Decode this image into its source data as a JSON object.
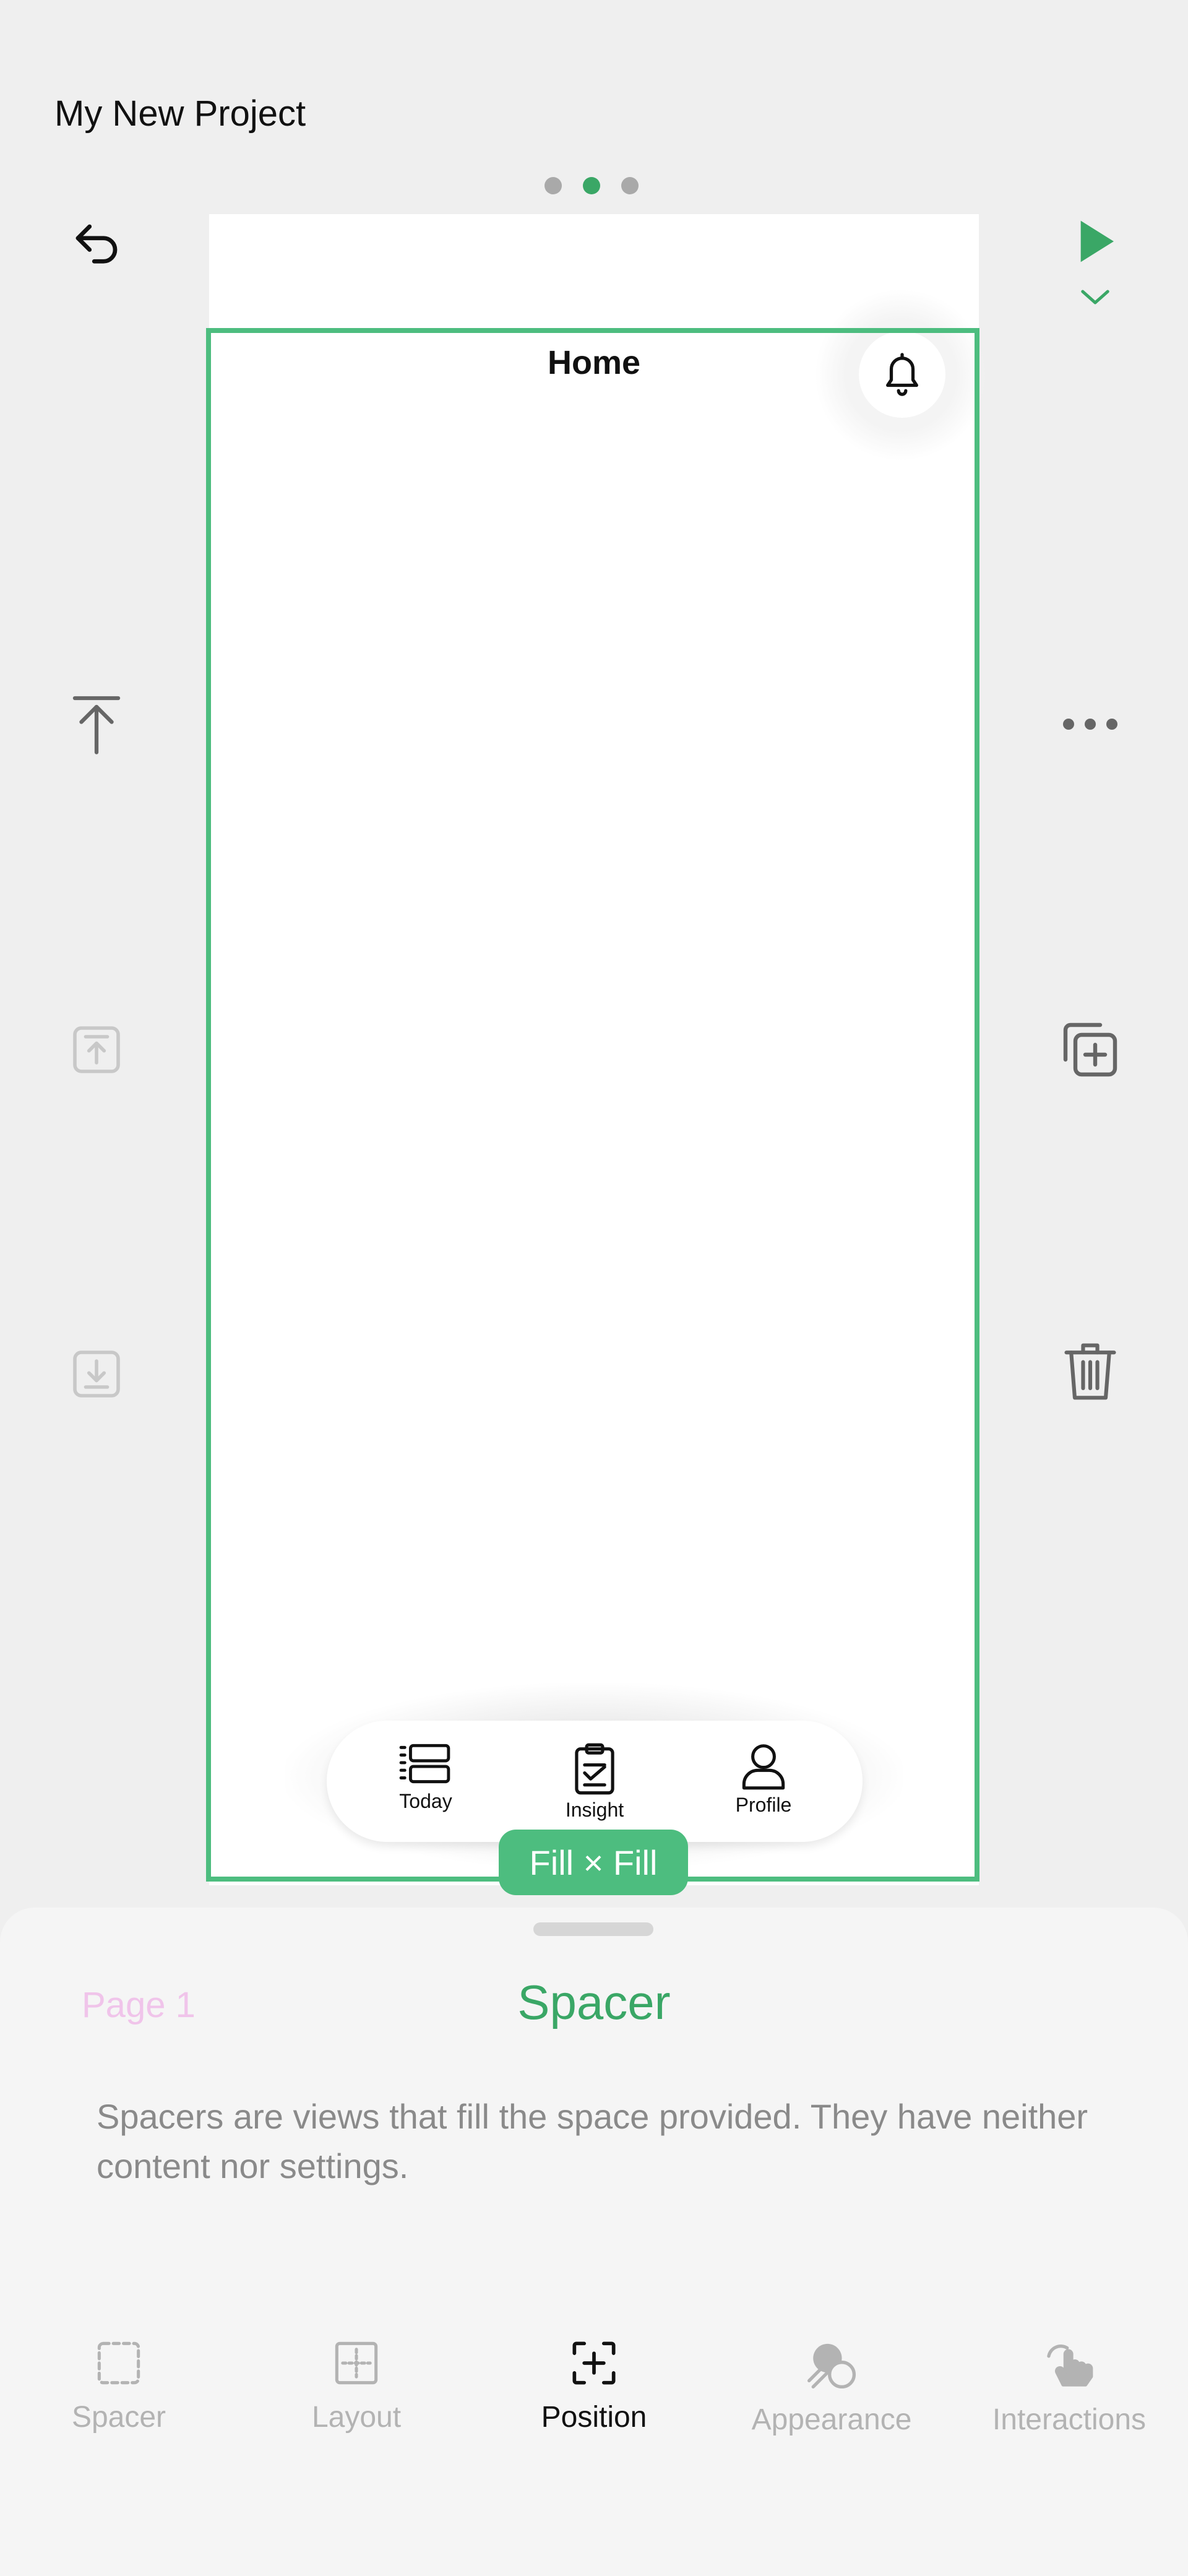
{
  "project": {
    "title": "My New Project"
  },
  "page_dots": {
    "count": 3,
    "active_index": 1
  },
  "toolbar_left": [
    "undo-icon",
    "move-to-top-icon",
    "move-up-icon",
    "move-down-icon"
  ],
  "toolbar_right": [
    "play-icon",
    "chevron-down-icon",
    "more-icon",
    "duplicate-icon",
    "trash-icon"
  ],
  "screen": {
    "title": "Home",
    "tabs": [
      {
        "label": "Today",
        "icon": "list-icon"
      },
      {
        "label": "Insight",
        "icon": "clipboard-check-icon"
      },
      {
        "label": "Profile",
        "icon": "person-icon"
      }
    ]
  },
  "selection": {
    "size_label": "Fill × Fill"
  },
  "sheet": {
    "page_link": "Page 1",
    "title": "Spacer",
    "description": "Spacers are views that fill the space provided. They have neither content nor settings.",
    "tabs": [
      {
        "label": "Spacer",
        "active": false
      },
      {
        "label": "Layout",
        "active": false
      },
      {
        "label": "Position",
        "active": true
      },
      {
        "label": "Appearance",
        "active": false
      },
      {
        "label": "Interactions",
        "active": false
      }
    ]
  },
  "colors": {
    "accent": "#4dbd7f",
    "accent_text": "#3aa766",
    "page_link": "#f0c4ea"
  }
}
